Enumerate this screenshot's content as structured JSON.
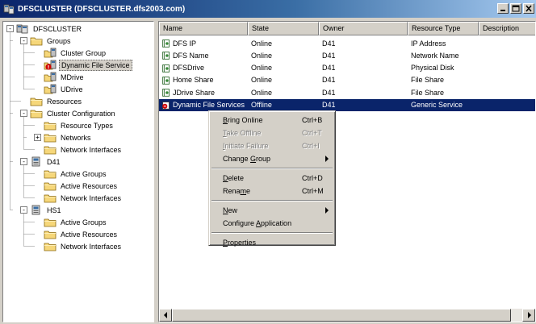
{
  "window": {
    "title": "DFSCLUSTER (DFSCLUSTER.dfs2003.com)"
  },
  "tree": {
    "items": [
      {
        "label": "DFSCLUSTER",
        "icon": "cluster-icon",
        "expander": "-"
      },
      {
        "label": "Groups",
        "icon": "folder-icon",
        "expander": "-"
      },
      {
        "label": "Cluster Group",
        "icon": "group-icon"
      },
      {
        "label": "Dynamic File Service",
        "icon": "group-error-icon",
        "selected": true
      },
      {
        "label": "MDrive",
        "icon": "group-icon"
      },
      {
        "label": "UDrive",
        "icon": "group-icon"
      },
      {
        "label": "Resources",
        "icon": "folder-icon"
      },
      {
        "label": "Cluster Configuration",
        "icon": "folder-icon",
        "expander": "-"
      },
      {
        "label": "Resource Types",
        "icon": "folder-icon"
      },
      {
        "label": "Networks",
        "icon": "folder-icon",
        "expander": "+"
      },
      {
        "label": "Network Interfaces",
        "icon": "folder-icon"
      },
      {
        "label": "D41",
        "icon": "server-icon",
        "expander": "-"
      },
      {
        "label": "Active Groups",
        "icon": "folder-icon"
      },
      {
        "label": "Active Resources",
        "icon": "folder-icon"
      },
      {
        "label": "Network Interfaces",
        "icon": "folder-icon"
      },
      {
        "label": "HS1",
        "icon": "server-icon",
        "expander": "-"
      },
      {
        "label": "Active Groups",
        "icon": "folder-icon"
      },
      {
        "label": "Active Resources",
        "icon": "folder-icon"
      },
      {
        "label": "Network Interfaces",
        "icon": "folder-icon"
      }
    ]
  },
  "list": {
    "columns": [
      "Name",
      "State",
      "Owner",
      "Resource Type",
      "Description"
    ],
    "rows": [
      {
        "name": "DFS IP",
        "state": "Online",
        "owner": "D41",
        "type": "IP Address",
        "description": ""
      },
      {
        "name": "DFS Name",
        "state": "Online",
        "owner": "D41",
        "type": "Network Name",
        "description": ""
      },
      {
        "name": "DFSDrive",
        "state": "Online",
        "owner": "D41",
        "type": "Physical Disk",
        "description": ""
      },
      {
        "name": "Home Share",
        "state": "Online",
        "owner": "D41",
        "type": "File Share",
        "description": ""
      },
      {
        "name": "JDrive Share",
        "state": "Online",
        "owner": "D41",
        "type": "File Share",
        "description": ""
      },
      {
        "name": "Dynamic File Services",
        "state": "Offline",
        "owner": "D41",
        "type": "Generic Service",
        "description": "",
        "selected": true
      }
    ]
  },
  "context_menu": {
    "items": [
      {
        "label": "Bring Online",
        "ul": "B",
        "shortcut": "Ctrl+B",
        "disabled": false
      },
      {
        "label": "Take Offline",
        "ul": "T",
        "shortcut": "Ctrl+T",
        "disabled": true
      },
      {
        "label": "Initiate Failure",
        "ul": "I",
        "shortcut": "Ctrl+I",
        "disabled": true
      },
      {
        "label": "Change Group",
        "ul": "G",
        "shortcut": "",
        "disabled": false,
        "submenu": true
      },
      {
        "separator": true
      },
      {
        "label": "Delete",
        "ul": "D",
        "shortcut": "Ctrl+D",
        "disabled": false
      },
      {
        "label": "Rename",
        "ul": "m",
        "shortcut": "Ctrl+M",
        "disabled": false
      },
      {
        "separator": true
      },
      {
        "label": "New",
        "ul": "N",
        "shortcut": "",
        "disabled": false,
        "submenu": true
      },
      {
        "label": "Configure Application",
        "ul": "A",
        "shortcut": "",
        "disabled": false
      },
      {
        "separator": true
      },
      {
        "label": "Properties",
        "ul": "P",
        "shortcut": "",
        "disabled": false
      }
    ]
  },
  "colors": {
    "selection": "#0a246a",
    "titlebar": "#0a246a",
    "face": "#d4d0c8"
  }
}
